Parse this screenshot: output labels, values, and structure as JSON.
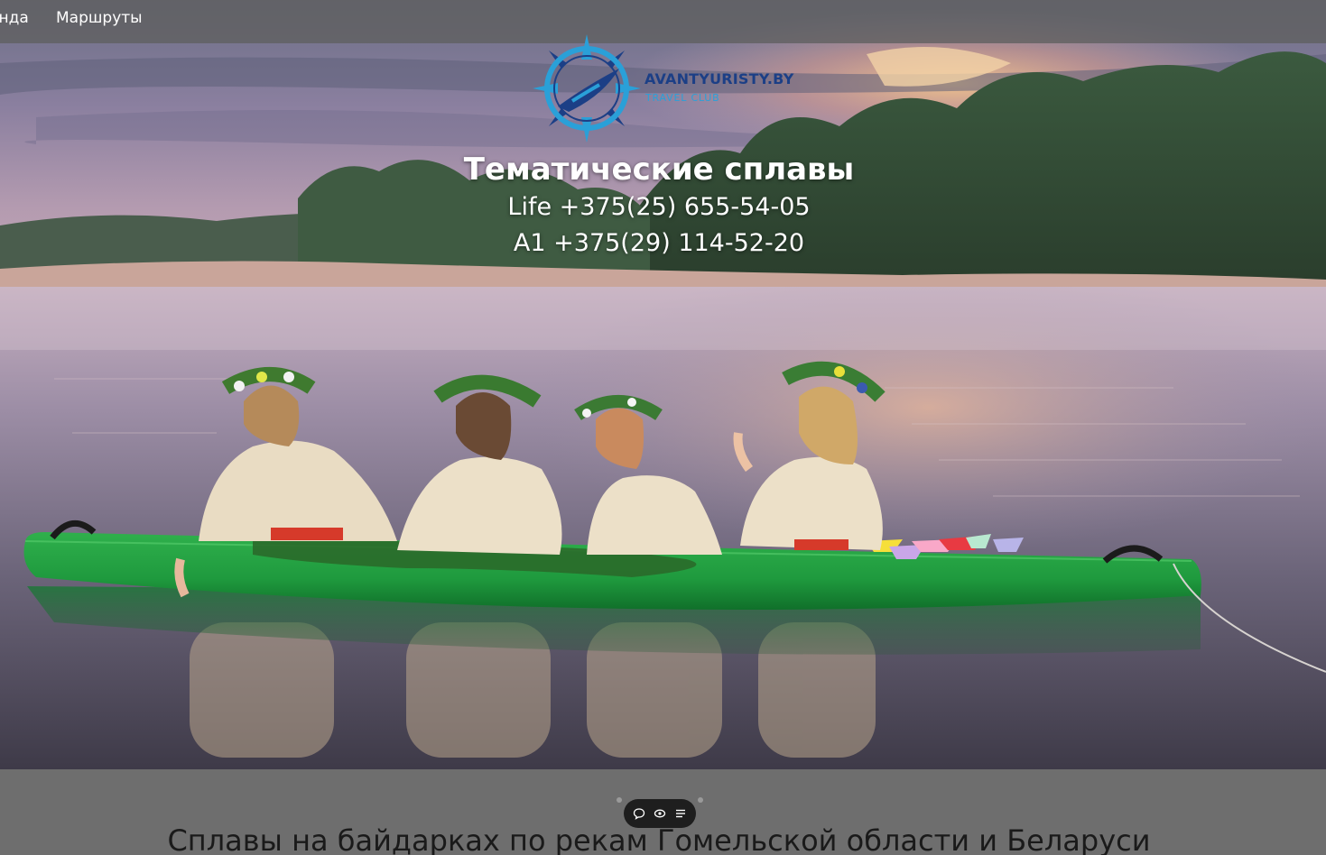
{
  "nav": {
    "items": [
      {
        "label": "енда"
      },
      {
        "label": "Маршруты"
      }
    ]
  },
  "logo": {
    "name": "AVANTYURISTY.BY",
    "tagline": "TRAVEL CLUB"
  },
  "hero": {
    "title": "Тематические сплавы",
    "phones": [
      "Life +375(25) 655-54-05",
      "A1 +375(29) 114-52-20"
    ]
  },
  "section": {
    "heading": "Сплавы на байдарках по рекам Гомельской области и Беларуси"
  },
  "toolbar": {
    "icons": [
      "comment-icon",
      "view-icon",
      "list-icon"
    ]
  },
  "colors": {
    "nav_bg": "#5f5f5f",
    "logo_blue": "#1c3f86",
    "logo_cyan": "#2aa0d8",
    "kayak_green": "#1f9a3e"
  }
}
